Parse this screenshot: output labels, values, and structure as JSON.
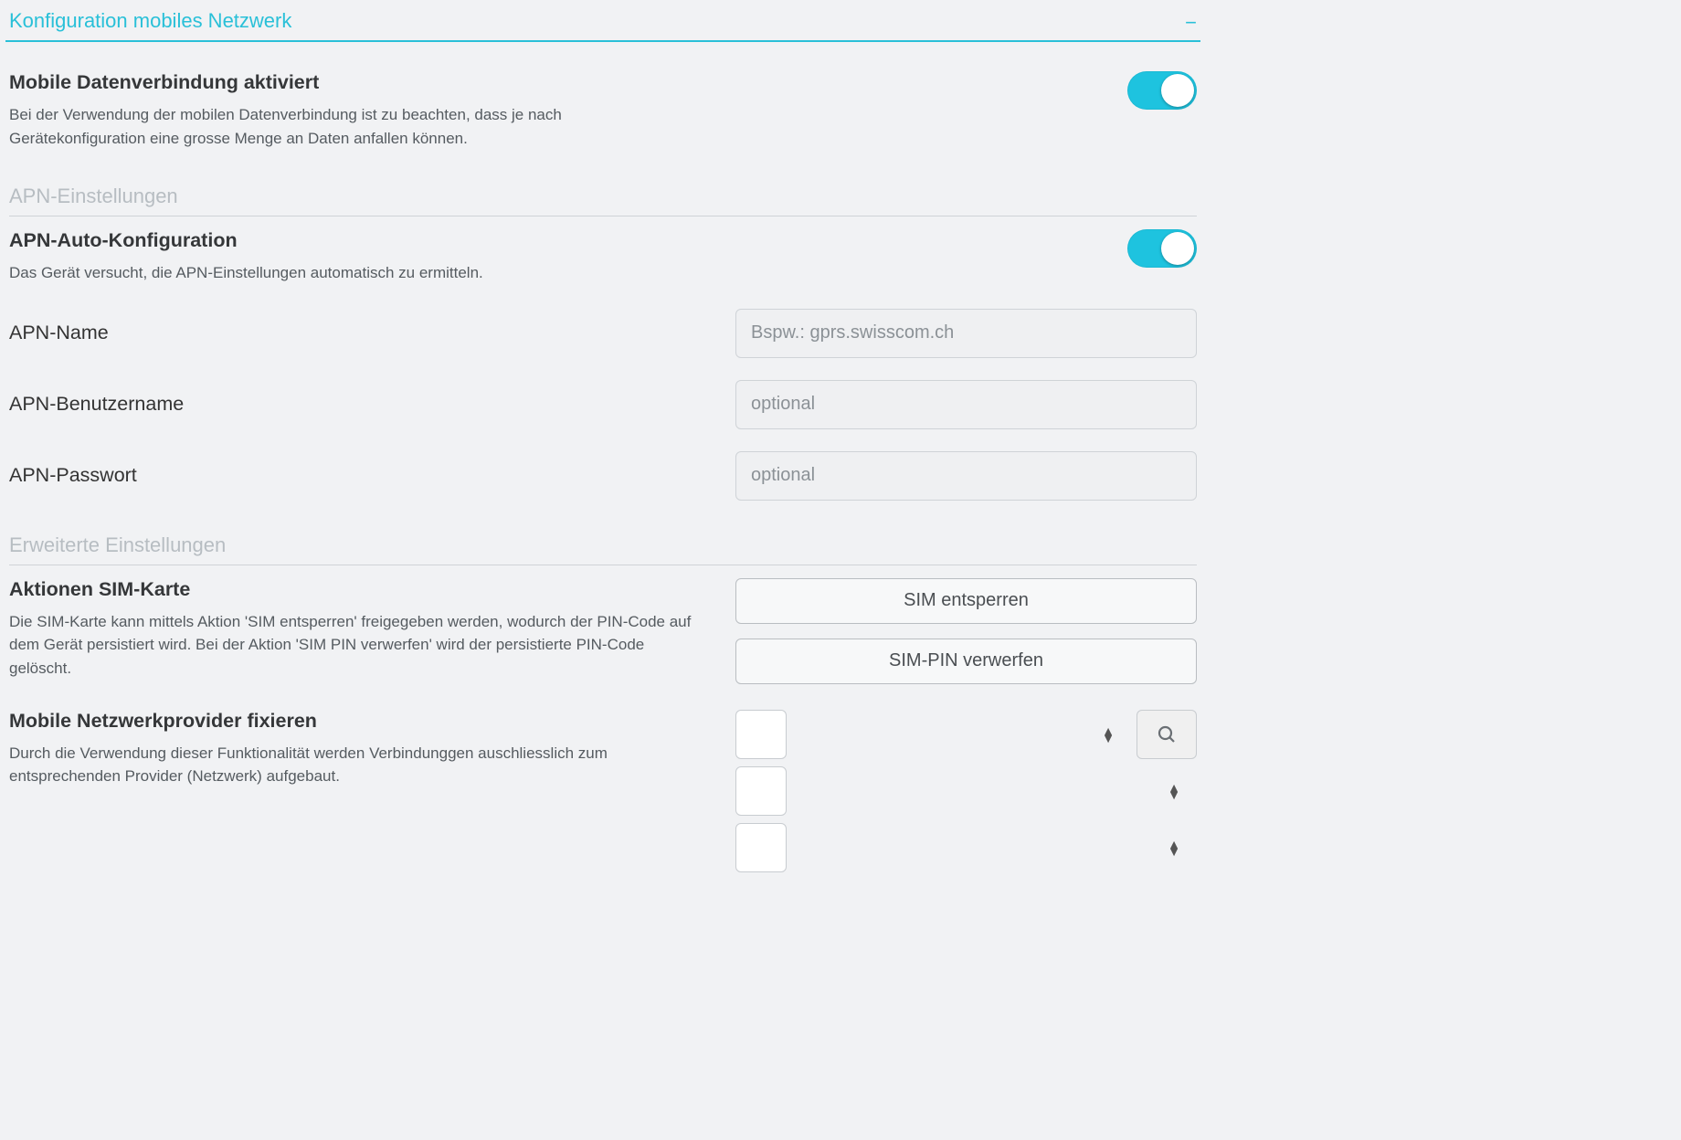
{
  "panel": {
    "title": "Konfiguration mobiles Netzwerk"
  },
  "mobile_data": {
    "title": "Mobile Datenverbindung aktiviert",
    "desc": "Bei der Verwendung der mobilen Datenverbindung ist zu beachten, dass je nach Gerätekonfiguration eine grosse Menge an Daten anfallen können.",
    "enabled": true
  },
  "section_apn": "APN-Einstellungen",
  "apn_auto": {
    "title": "APN-Auto-Konfiguration",
    "desc": "Das Gerät versucht, die APN-Einstellungen automatisch zu ermitteln.",
    "enabled": true
  },
  "apn_name": {
    "label": "APN-Name",
    "placeholder": "Bspw.: gprs.swisscom.ch",
    "value": ""
  },
  "apn_user": {
    "label": "APN-Benutzername",
    "placeholder": "optional",
    "value": ""
  },
  "apn_pass": {
    "label": "APN-Passwort",
    "placeholder": "optional",
    "value": ""
  },
  "section_advanced": "Erweiterte Einstellungen",
  "sim_actions": {
    "title": "Aktionen SIM-Karte",
    "desc": "Die SIM-Karte kann mittels Aktion 'SIM entsperren' freigegeben werden, wodurch der PIN-Code auf dem Gerät persistiert wird. Bei der Aktion 'SIM PIN verwerfen' wird der persistierte PIN-Code gelöscht.",
    "unlock_label": "SIM entsperren",
    "discard_label": "SIM-PIN verwerfen"
  },
  "provider_lock": {
    "title": "Mobile Netzwerkprovider fixieren",
    "desc": "Durch die Verwendung dieser Funktionalität werden Verbindunggen auschliesslich zum entsprechenden Provider (Netzwerk) aufgebaut.",
    "select1_value": "",
    "select2_value": "",
    "select3_value": ""
  }
}
